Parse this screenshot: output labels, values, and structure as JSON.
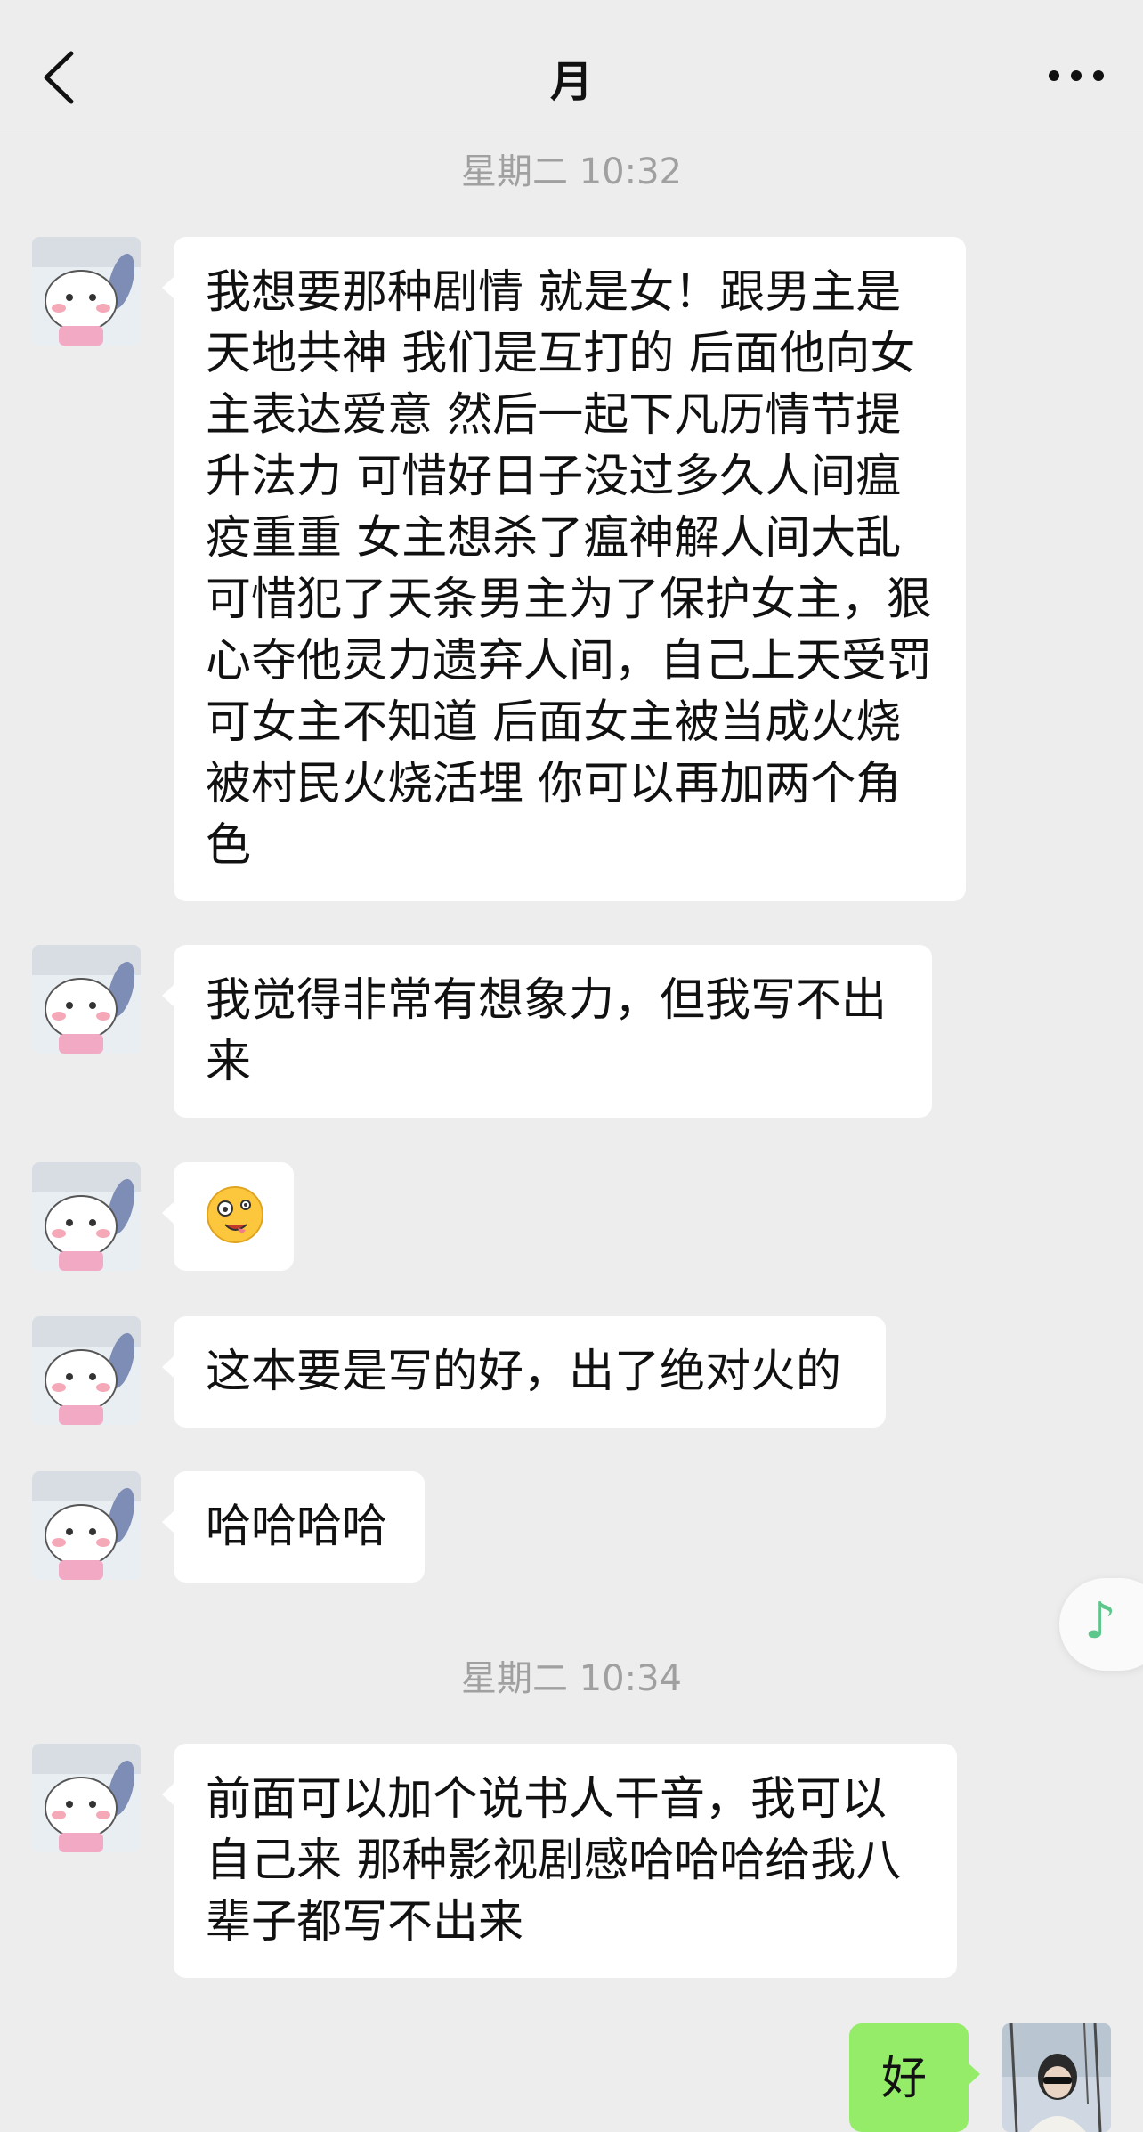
{
  "header": {
    "title": "月"
  },
  "timestamps": [
    "星期二 10:32",
    "星期二 10:34"
  ],
  "messages": [
    {
      "text": "我想要那种剧情 就是女！跟男主是天地共神 我们是互打的 后面他向女主表达爱意 然后一起下凡历情节提升法力 可惜好日子没过多久人间瘟疫重重 女主想杀了瘟神解人间大乱 可惜犯了天条男主为了保护女主，狠心夺他灵力遗弃人间，自己上天受罚  可女主不知道 后面女主被当成火烧被村民火烧活埋  你可以再加两个角色"
    },
    {
      "text": "我觉得非常有想象力，但我写不出来"
    },
    {
      "emoji": "zany-face"
    },
    {
      "text": "这本要是写的好，出了绝对火的"
    },
    {
      "text": "哈哈哈哈"
    },
    {
      "text": "前面可以加个说书人干音，我可以自己来  那种影视剧感哈哈哈给我八辈子都写不出来"
    },
    {
      "text": "好",
      "side": "right"
    }
  ],
  "icons": {
    "back": "chevron-left-icon",
    "more": "more-dots-icon",
    "music": "music-note-icon",
    "music_glyph": "♪"
  },
  "colors": {
    "background": "#ededed",
    "incoming_bubble": "#ffffff",
    "outgoing_bubble": "#95ec69",
    "timestamp": "#a0a0a0",
    "music_accent": "#5cc78a"
  }
}
